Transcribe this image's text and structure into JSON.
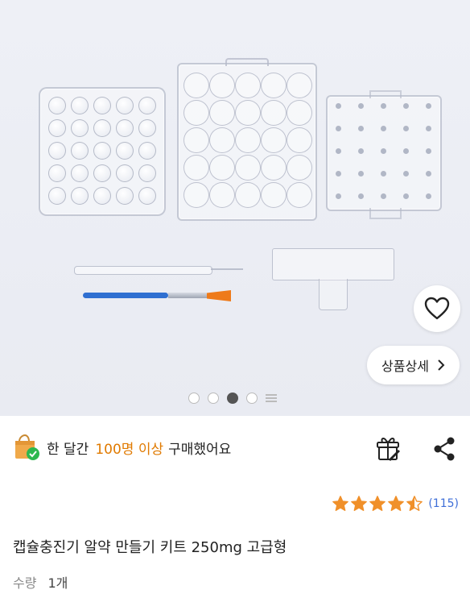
{
  "gallery": {
    "detail_label": "상품상세",
    "pages": 4,
    "active_page": 2
  },
  "purchase_stat": {
    "prefix": "한 달간",
    "highlight": "100명 이상",
    "suffix": "구매했어요"
  },
  "rating": {
    "stars": 4.5,
    "count": "(115)"
  },
  "product": {
    "title": "캡슐충진기 알약 만들기 키트 250mg 고급형"
  },
  "quantity": {
    "label": "수량",
    "value": "1개"
  },
  "colors": {
    "accent": "#e07a00",
    "star": "#f0902a",
    "link": "#3f6fd8"
  },
  "icons": [
    "shopping-bag-icon",
    "check-badge-icon",
    "heart-icon",
    "chevron-right-icon",
    "gift-icon",
    "share-icon",
    "star-icon"
  ]
}
